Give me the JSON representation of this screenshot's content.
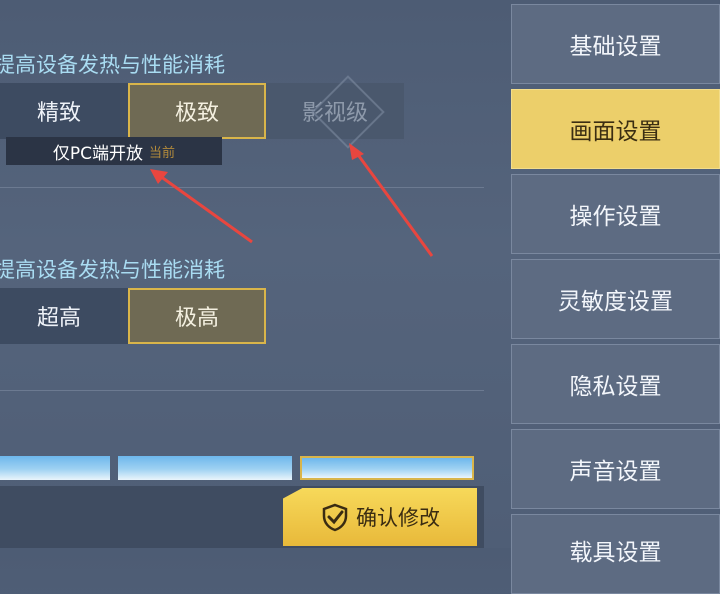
{
  "main": {
    "section1_text": "提高设备发热与性能消耗",
    "section2_text": "提高设备发热与性能消耗",
    "quality_options": [
      {
        "label": "精致",
        "state": "normal"
      },
      {
        "label": "极致",
        "state": "selected"
      },
      {
        "label": "影视级",
        "state": "disabled"
      }
    ],
    "framerate_options": [
      {
        "label": "超高",
        "state": "normal"
      },
      {
        "label": "极高",
        "state": "selected"
      }
    ],
    "tooltip": {
      "text": "仅PC端开放",
      "ghost": "当前"
    },
    "confirm_label": "确认修改"
  },
  "sidebar": {
    "items": [
      {
        "label": "基础设置",
        "active": false
      },
      {
        "label": "画面设置",
        "active": true
      },
      {
        "label": "操作设置",
        "active": false
      },
      {
        "label": "灵敏度设置",
        "active": false
      },
      {
        "label": "隐私设置",
        "active": false
      },
      {
        "label": "声音设置",
        "active": false
      },
      {
        "label": "载具设置",
        "active": false
      }
    ]
  },
  "colors": {
    "accent": "#eccf6a",
    "annotation_arrow": "#e8463f"
  }
}
